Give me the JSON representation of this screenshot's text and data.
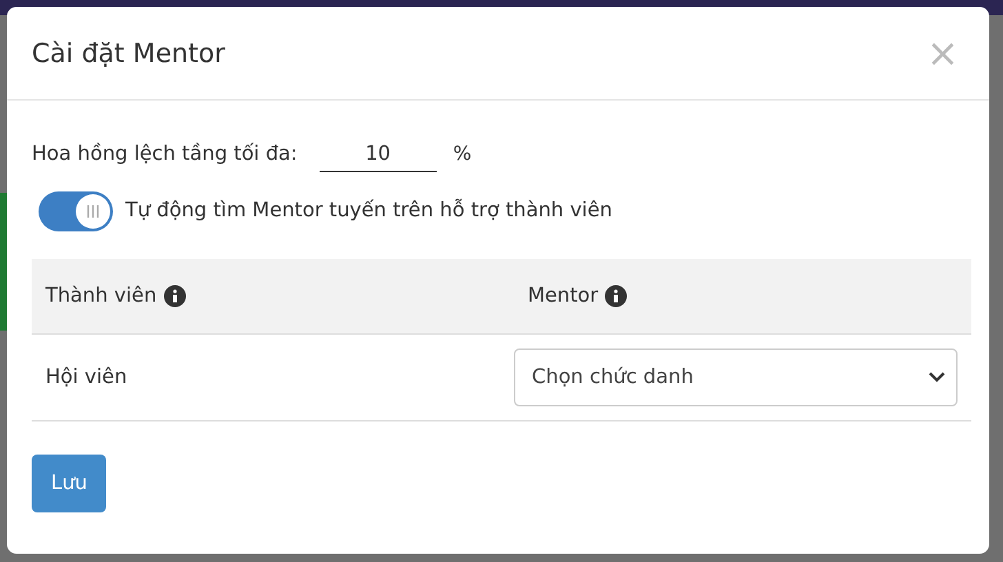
{
  "dialog": {
    "title": "Cài đặt Mentor",
    "close": "×"
  },
  "commission": {
    "label": "Hoa hồng lệch tầng tối đa:",
    "value": "10",
    "unit": "%"
  },
  "auto_mentor": {
    "label": "Tự động tìm Mentor tuyến trên hỗ trợ thành viên",
    "on": true
  },
  "table": {
    "columns": [
      {
        "label": "Thành viên",
        "info": true
      },
      {
        "label": "Mentor",
        "info": true
      }
    ],
    "rows": [
      {
        "member": "Hội viên",
        "mentor_select": "Chọn chức danh"
      }
    ]
  },
  "buttons": [
    {
      "label": "Lưu"
    }
  ]
}
